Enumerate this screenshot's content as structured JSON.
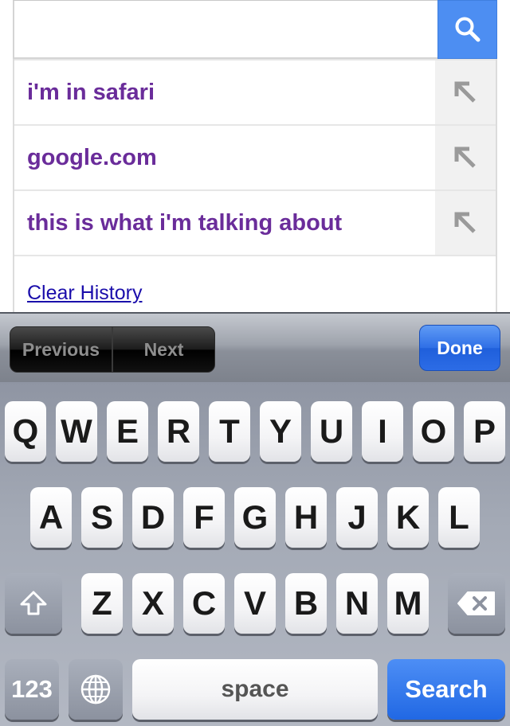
{
  "search": {
    "value": "",
    "suggestions": [
      {
        "label": "i'm in safari"
      },
      {
        "label": "google.com"
      },
      {
        "label": "this is what i'm talking about"
      }
    ],
    "clear_history": "Clear History"
  },
  "form_bar": {
    "previous": "Previous",
    "next": "Next",
    "done": "Done"
  },
  "keyboard": {
    "row1": [
      "Q",
      "W",
      "E",
      "R",
      "T",
      "Y",
      "U",
      "I",
      "O",
      "P"
    ],
    "row2": [
      "A",
      "S",
      "D",
      "F",
      "G",
      "H",
      "J",
      "K",
      "L"
    ],
    "row3": [
      "Z",
      "X",
      "C",
      "V",
      "B",
      "N",
      "M"
    ],
    "numbers_key": "123",
    "space_key": "space",
    "return_key": "Search"
  },
  "colors": {
    "search_blue": "#4d8ef2",
    "suggestion_purple": "#6a2c9a",
    "link_blue": "#1a0dab"
  }
}
